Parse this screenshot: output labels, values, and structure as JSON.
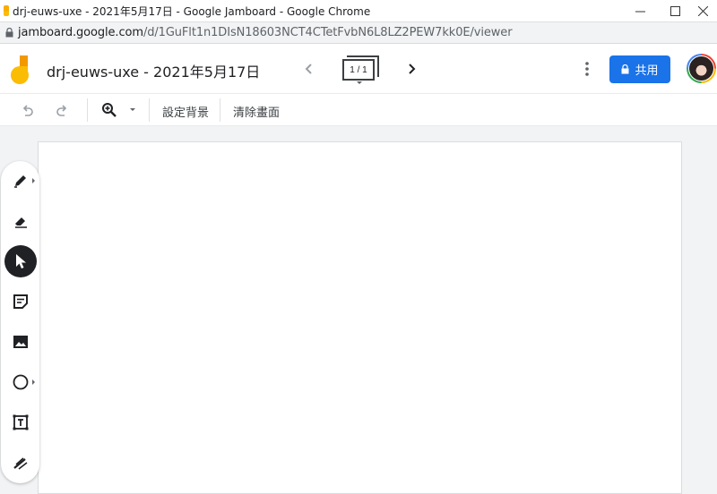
{
  "window": {
    "title": "drj-euws-uxe - 2021年5月17日 - Google Jamboard - Google Chrome",
    "controls": [
      "minimize",
      "maximize",
      "close"
    ]
  },
  "address_bar": {
    "host": "jamboard.google.com",
    "path": "/d/1GuFlt1n1DIsN18603NCT4CTetFvbN6L8LZ2PEW7kk0E/viewer"
  },
  "app": {
    "document_title": "drj-euws-uxe - 2021年5月17日",
    "frame_indicator": "1 / 1",
    "share_label": "共用",
    "brand_color": "#1a73e8"
  },
  "toolbar": {
    "set_background": "設定背景",
    "clear_frame": "清除畫面"
  },
  "tools": [
    {
      "name": "pen-icon",
      "has_submenu": true
    },
    {
      "name": "eraser-icon",
      "has_submenu": false
    },
    {
      "name": "select-icon",
      "has_submenu": false,
      "active": true
    },
    {
      "name": "sticky-note-icon",
      "has_submenu": false
    },
    {
      "name": "image-icon",
      "has_submenu": false
    },
    {
      "name": "circle-icon",
      "has_submenu": true
    },
    {
      "name": "text-box-icon",
      "has_submenu": false
    },
    {
      "name": "laser-icon",
      "has_submenu": false
    }
  ]
}
